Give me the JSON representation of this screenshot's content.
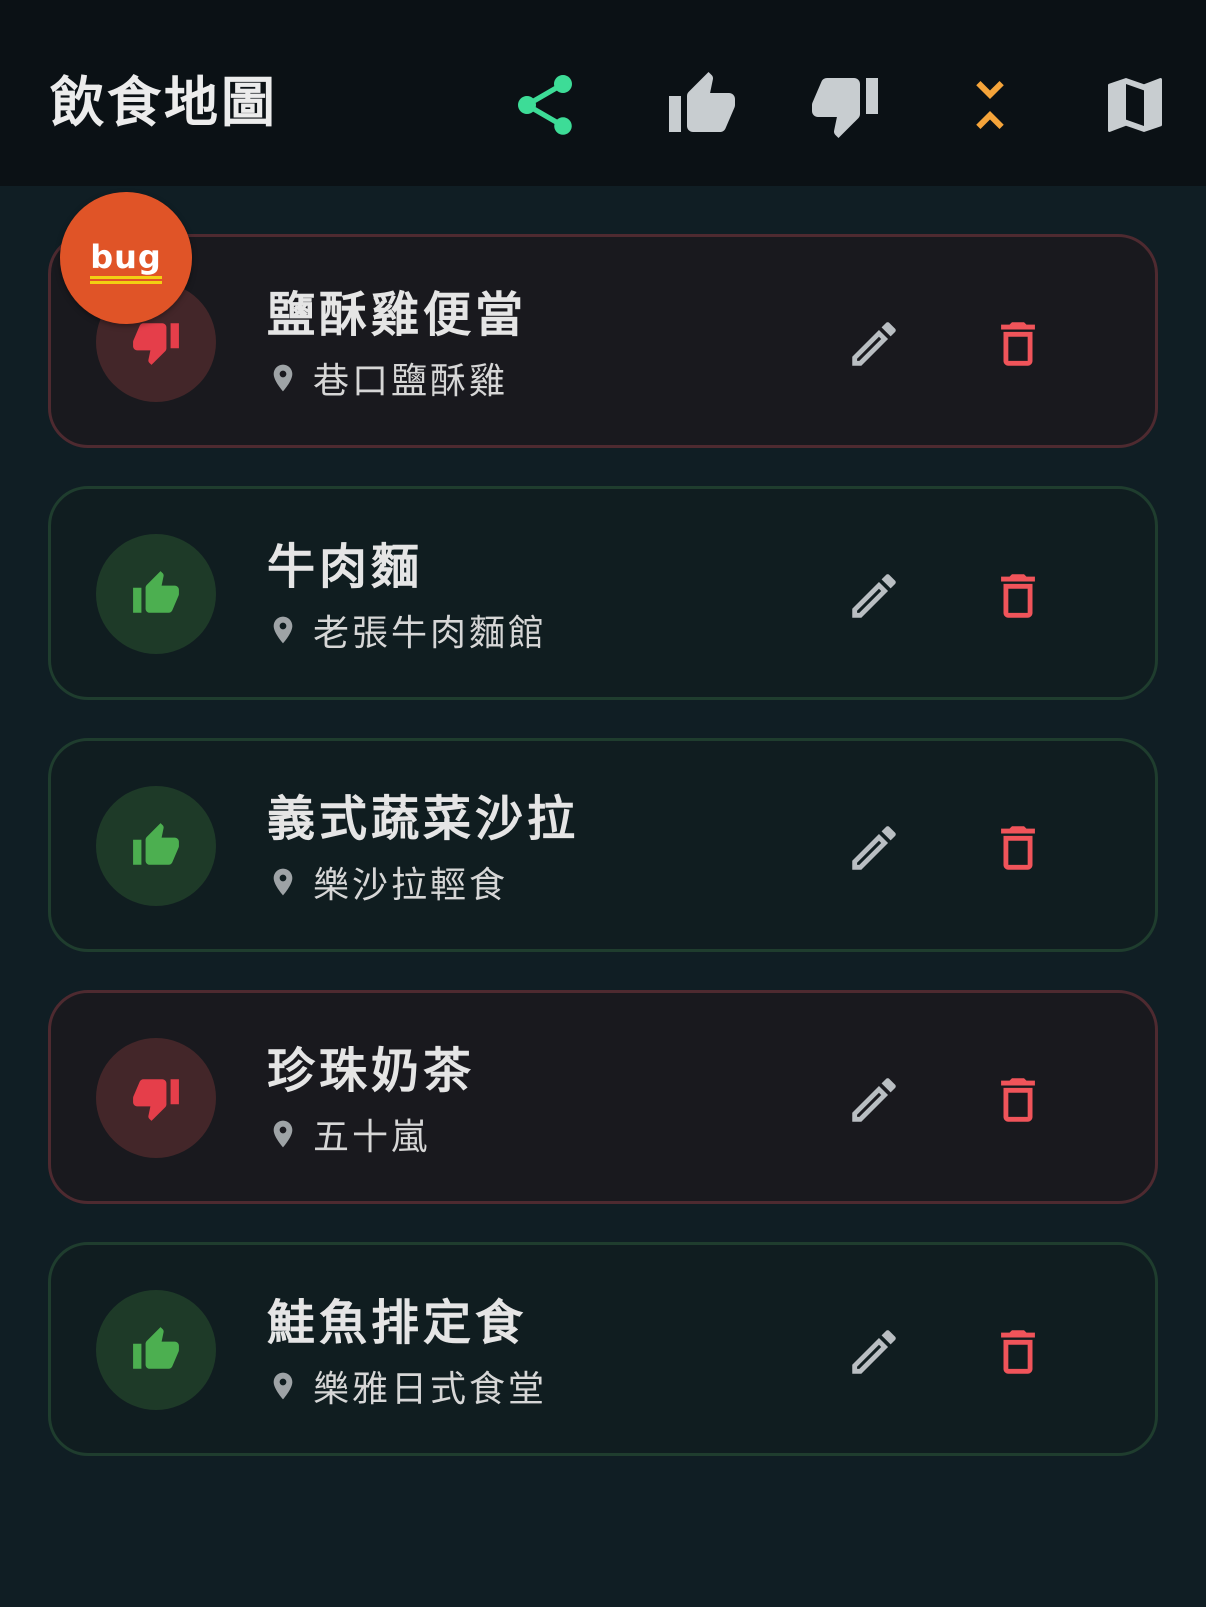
{
  "app": {
    "title": "飲食地圖",
    "toolbar": [
      {
        "name": "share-button",
        "icon": "share-icon",
        "color": "#3ddc97"
      },
      {
        "name": "filter-like-button",
        "icon": "thumb-up-icon",
        "color": "#c8cdd0"
      },
      {
        "name": "filter-dislike-button",
        "icon": "thumb-down-icon",
        "color": "#c8cdd0"
      },
      {
        "name": "collapse-button",
        "icon": "collapse-icon",
        "color": "#f5a43a"
      },
      {
        "name": "map-button",
        "icon": "map-icon",
        "color": "#c8cdd0"
      }
    ]
  },
  "entries": [
    {
      "title": "鹽酥雞便當",
      "location": "巷口鹽酥雞",
      "rating": "dislike"
    },
    {
      "title": "牛肉麵",
      "location": "老張牛肉麵館",
      "rating": "like"
    },
    {
      "title": "義式蔬菜沙拉",
      "location": "樂沙拉輕食",
      "rating": "like"
    },
    {
      "title": "珍珠奶茶",
      "location": "五十嵐",
      "rating": "dislike"
    },
    {
      "title": "鮭魚排定食",
      "location": "樂雅日式食堂",
      "rating": "like"
    }
  ],
  "debug_badge": {
    "label": "bug"
  },
  "colors": {
    "like": "#4caf50",
    "dislike": "#e53e4a",
    "delete": "#f0545a",
    "edit": "#b9bec2",
    "pin": "#9ea3a6"
  }
}
